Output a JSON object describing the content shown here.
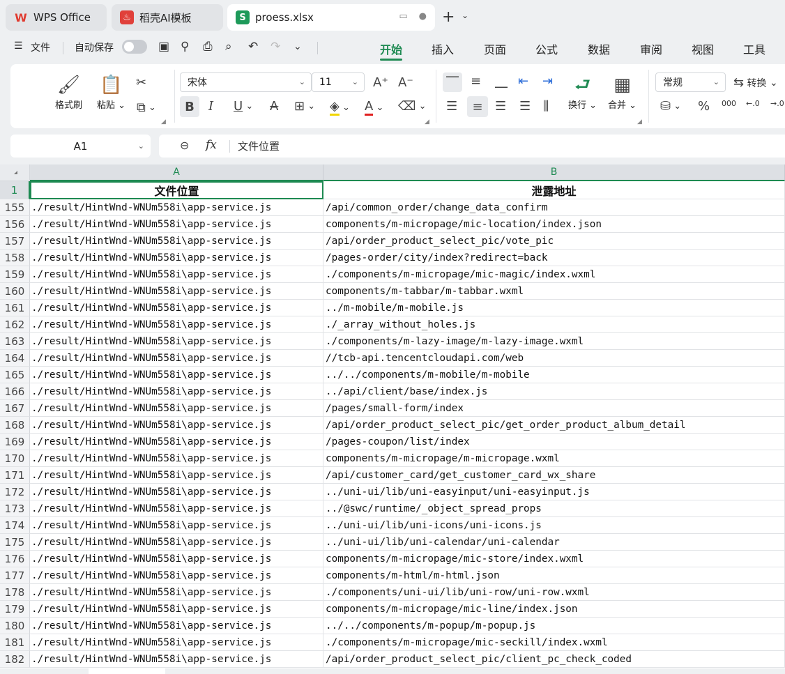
{
  "tabs": [
    {
      "label": "WPS Office",
      "icon": "wps-logo-icon",
      "color": "#e03a2f"
    },
    {
      "label": "稻壳AI模板",
      "icon": "docer-icon",
      "color": "#e0403a"
    },
    {
      "label": "proess.xlsx",
      "icon": "spreadsheet-icon",
      "color": "#1e9a5a"
    }
  ],
  "menu": {
    "file_label": "文件",
    "autosave_label": "自动保存"
  },
  "ribbon_tabs": [
    "开始",
    "插入",
    "页面",
    "公式",
    "数据",
    "审阅",
    "视图",
    "工具"
  ],
  "active_ribbon_tab": "开始",
  "ribbon": {
    "format_painter": "格式刷",
    "paste": "粘贴",
    "font_name": "宋体",
    "font_size": "11",
    "wrap_text": "换行",
    "merge": "合并",
    "number_format": "常规",
    "convert": "转换"
  },
  "formula_bar": {
    "name_box": "A1",
    "fx_label": "fx",
    "value": "文件位置"
  },
  "columns": [
    "A",
    "B"
  ],
  "header_row": {
    "row": "1",
    "a": "文件位置",
    "b": "泄露地址"
  },
  "rows": [
    {
      "n": "155",
      "a": "./result/HintWnd-WNUm558i\\app-service.js",
      "b": "/api/common_order/change_data_confirm"
    },
    {
      "n": "156",
      "a": "./result/HintWnd-WNUm558i\\app-service.js",
      "b": "components/m-micropage/mic-location/index.json"
    },
    {
      "n": "157",
      "a": "./result/HintWnd-WNUm558i\\app-service.js",
      "b": "/api/order_product_select_pic/vote_pic"
    },
    {
      "n": "158",
      "a": "./result/HintWnd-WNUm558i\\app-service.js",
      "b": "/pages-order/city/index?redirect=back"
    },
    {
      "n": "159",
      "a": "./result/HintWnd-WNUm558i\\app-service.js",
      "b": "./components/m-micropage/mic-magic/index.wxml"
    },
    {
      "n": "160",
      "a": "./result/HintWnd-WNUm558i\\app-service.js",
      "b": "components/m-tabbar/m-tabbar.wxml"
    },
    {
      "n": "161",
      "a": "./result/HintWnd-WNUm558i\\app-service.js",
      "b": "../m-mobile/m-mobile.js"
    },
    {
      "n": "162",
      "a": "./result/HintWnd-WNUm558i\\app-service.js",
      "b": "./_array_without_holes.js"
    },
    {
      "n": "163",
      "a": "./result/HintWnd-WNUm558i\\app-service.js",
      "b": "./components/m-lazy-image/m-lazy-image.wxml"
    },
    {
      "n": "164",
      "a": "./result/HintWnd-WNUm558i\\app-service.js",
      "b": "//tcb-api.tencentcloudapi.com/web"
    },
    {
      "n": "165",
      "a": "./result/HintWnd-WNUm558i\\app-service.js",
      "b": "../../components/m-mobile/m-mobile"
    },
    {
      "n": "166",
      "a": "./result/HintWnd-WNUm558i\\app-service.js",
      "b": "../api/client/base/index.js"
    },
    {
      "n": "167",
      "a": "./result/HintWnd-WNUm558i\\app-service.js",
      "b": "/pages/small-form/index"
    },
    {
      "n": "168",
      "a": "./result/HintWnd-WNUm558i\\app-service.js",
      "b": "/api/order_product_select_pic/get_order_product_album_detail"
    },
    {
      "n": "169",
      "a": "./result/HintWnd-WNUm558i\\app-service.js",
      "b": "/pages-coupon/list/index"
    },
    {
      "n": "170",
      "a": "./result/HintWnd-WNUm558i\\app-service.js",
      "b": "components/m-micropage/m-micropage.wxml"
    },
    {
      "n": "171",
      "a": "./result/HintWnd-WNUm558i\\app-service.js",
      "b": "/api/customer_card/get_customer_card_wx_share"
    },
    {
      "n": "172",
      "a": "./result/HintWnd-WNUm558i\\app-service.js",
      "b": "../uni-ui/lib/uni-easyinput/uni-easyinput.js"
    },
    {
      "n": "173",
      "a": "./result/HintWnd-WNUm558i\\app-service.js",
      "b": "../@swc/runtime/_object_spread_props"
    },
    {
      "n": "174",
      "a": "./result/HintWnd-WNUm558i\\app-service.js",
      "b": "../uni-ui/lib/uni-icons/uni-icons.js"
    },
    {
      "n": "175",
      "a": "./result/HintWnd-WNUm558i\\app-service.js",
      "b": "../uni-ui/lib/uni-calendar/uni-calendar"
    },
    {
      "n": "176",
      "a": "./result/HintWnd-WNUm558i\\app-service.js",
      "b": "components/m-micropage/mic-store/index.wxml"
    },
    {
      "n": "177",
      "a": "./result/HintWnd-WNUm558i\\app-service.js",
      "b": "components/m-html/m-html.json"
    },
    {
      "n": "178",
      "a": "./result/HintWnd-WNUm558i\\app-service.js",
      "b": "./components/uni-ui/lib/uni-row/uni-row.wxml"
    },
    {
      "n": "179",
      "a": "./result/HintWnd-WNUm558i\\app-service.js",
      "b": "components/m-micropage/mic-line/index.json"
    },
    {
      "n": "180",
      "a": "./result/HintWnd-WNUm558i\\app-service.js",
      "b": "../../components/m-popup/m-popup.js"
    },
    {
      "n": "181",
      "a": "./result/HintWnd-WNUm558i\\app-service.js",
      "b": "./components/m-micropage/mic-seckill/index.wxml"
    },
    {
      "n": "182",
      "a": "./result/HintWnd-WNUm558i\\app-service.js",
      "b": "/api/order_product_select_pic/client_pc_check_coded"
    }
  ],
  "accent_color": "#1e8a52"
}
